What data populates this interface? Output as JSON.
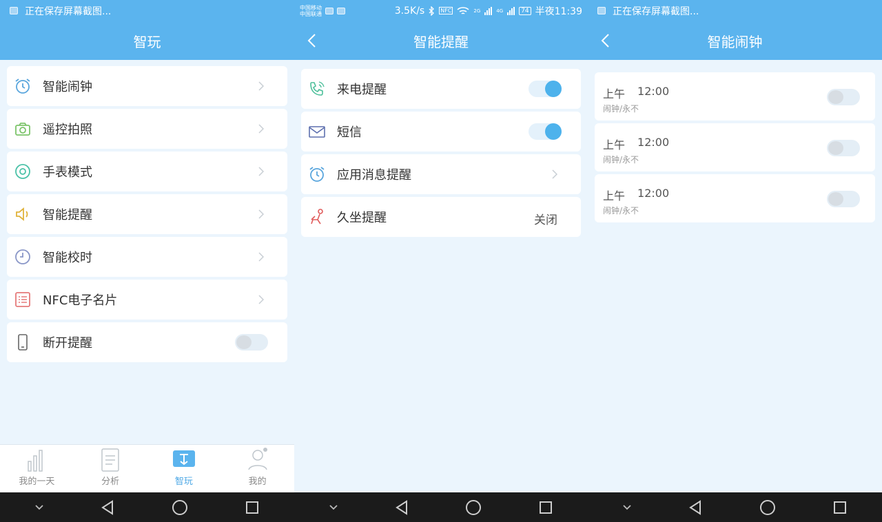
{
  "panel1": {
    "status_text": "正在保存屏幕截图...",
    "title": "智玩",
    "items": [
      {
        "label": "智能闹钟"
      },
      {
        "label": "遥控拍照"
      },
      {
        "label": "手表模式"
      },
      {
        "label": "智能提醒"
      },
      {
        "label": "智能校时"
      },
      {
        "label": "NFC电子名片"
      },
      {
        "label": "断开提醒"
      }
    ],
    "tabs": [
      {
        "label": "我的一天"
      },
      {
        "label": "分析"
      },
      {
        "label": "智玩"
      },
      {
        "label": "我的"
      }
    ]
  },
  "panel2": {
    "status": {
      "carrier1": "中国移动",
      "carrier2": "中国联通",
      "speed": "3.5K/s",
      "net2g": "2G",
      "net4g": "4G",
      "battery": "74",
      "time": "半夜11:39"
    },
    "title": "智能提醒",
    "items": [
      {
        "label": "来电提醒"
      },
      {
        "label": "短信"
      },
      {
        "label": "应用消息提醒"
      },
      {
        "label": "久坐提醒",
        "value": "关闭"
      }
    ]
  },
  "panel3": {
    "status_text": "正在保存屏幕截图...",
    "title": "智能闹钟",
    "alarms": [
      {
        "period": "上午",
        "time": "12:00",
        "repeat": "闹钟/永不"
      },
      {
        "period": "上午",
        "time": "12:00",
        "repeat": "闹钟/永不"
      },
      {
        "period": "上午",
        "time": "12:00",
        "repeat": "闹钟/永不"
      }
    ]
  },
  "colors": {
    "accent": "#5bb4ee",
    "toggle_on": "#4db2ec",
    "nav": "#1b1b1b"
  }
}
